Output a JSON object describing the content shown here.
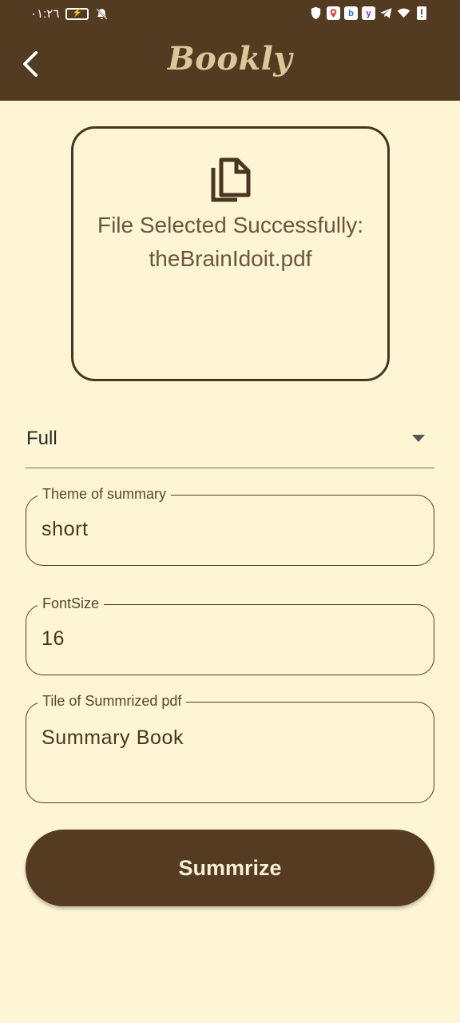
{
  "status_bar": {
    "time": "٠١:٢٦",
    "icons": [
      "battery-charging-icon",
      "notifications-off-icon",
      "vpn-shield-icon",
      "maps-app-icon",
      "bing-app-icon",
      "yahoo-app-icon",
      "telegram-icon",
      "wifi-icon",
      "alert-icon"
    ],
    "app_chip_b": "b",
    "app_chip_y": "y"
  },
  "app_bar": {
    "title": "Bookly",
    "back_icon": "chevron-left-icon",
    "background": "#533b22",
    "title_color": "#dbc89a"
  },
  "file_card": {
    "icon": "copy-file-icon",
    "line1": "File Selected Successfully:",
    "line2": "theBrainIdoit.pdf"
  },
  "dropdown": {
    "selected": "Full",
    "icon": "dropdown-arrow-icon"
  },
  "fields": {
    "theme": {
      "label": "Theme of summary",
      "value": "short"
    },
    "font_size": {
      "label": "FontSize",
      "value": "16"
    },
    "title": {
      "label": "Tile of Summrized pdf",
      "value": "Summary Book"
    }
  },
  "button": {
    "label": "Summrize",
    "color": "#553b22"
  },
  "colors": {
    "background": "#fdf5d3",
    "accent": "#533b22"
  }
}
